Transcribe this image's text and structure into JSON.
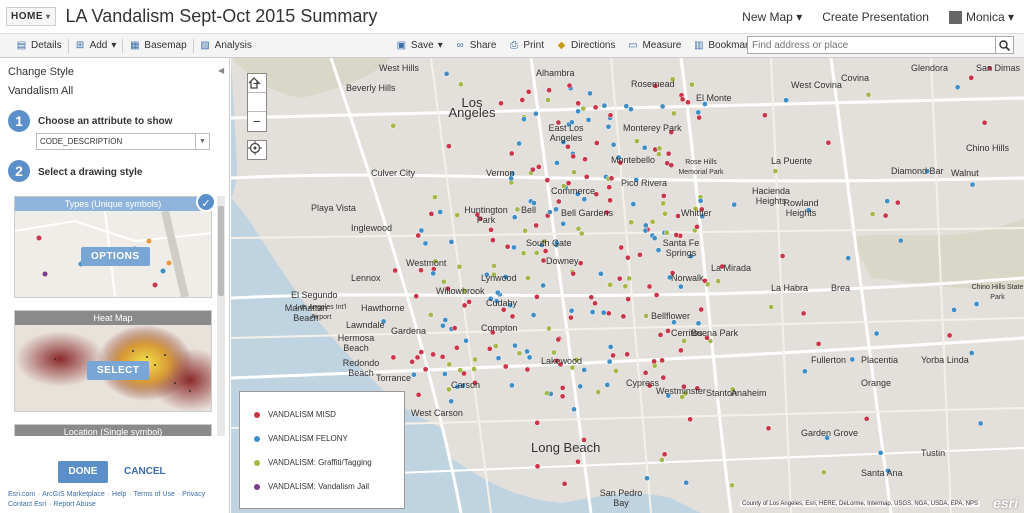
{
  "header": {
    "home_label": "HOME",
    "title": "LA Vandalism Sept-Oct 2015 Summary",
    "new_map": "New Map",
    "create_presentation": "Create Presentation",
    "user": "Monica"
  },
  "toolbar": {
    "details": "Details",
    "add": "Add",
    "basemap": "Basemap",
    "analysis": "Analysis",
    "save": "Save",
    "share": "Share",
    "print": "Print",
    "directions": "Directions",
    "measure": "Measure",
    "bookmarks": "Bookmarks",
    "search_placeholder": "Find address or place"
  },
  "panel": {
    "heading": "Change Style",
    "layer": "Vandalism All",
    "step1_num": "1",
    "step1_label": "Choose an attribute to show",
    "attribute": "CODE_DESCRIPTION",
    "step2_num": "2",
    "step2_label": "Select a drawing style",
    "styles": [
      {
        "title": "Types (Unique symbols)",
        "button": "OPTIONS"
      },
      {
        "title": "Heat Map",
        "button": "SELECT"
      },
      {
        "title": "Location (Single symbol)"
      }
    ],
    "done": "DONE",
    "cancel": "CANCEL",
    "footer": [
      "Esri.com",
      "ArcGIS Marketplace",
      "Help",
      "Terms of Use",
      "Privacy",
      "Contact Esri",
      "Report Abuse"
    ]
  },
  "legend": [
    {
      "label": "VANDALISM MISD",
      "color": "#c8364a"
    },
    {
      "label": "VANDALISM FELONY",
      "color": "#3f8ec5"
    },
    {
      "label": "VANDALISM: Graffiti/Tagging",
      "color": "#a3b849"
    },
    {
      "label": "VANDALISM: Vandalism Jail",
      "color": "#7a3c8a"
    }
  ],
  "map": {
    "attribution": "County of Los Angeles, Esri, HERE, DeLorme, Intermap, USGS, NGA, USDA, EPA, NPS",
    "logo": "esri",
    "cities": [
      {
        "name": "West Hills"
      },
      {
        "name": "Beverly Hills"
      },
      {
        "name": "Los Angeles"
      },
      {
        "name": "Alhambra"
      },
      {
        "name": "Rosemead"
      },
      {
        "name": "El Monte"
      },
      {
        "name": "West Covina"
      },
      {
        "name": "Covina"
      },
      {
        "name": "Glendora"
      },
      {
        "name": "San Dimas"
      },
      {
        "name": "East Los Angeles"
      },
      {
        "name": "Monterey Park"
      },
      {
        "name": "Montebello"
      },
      {
        "name": "Rose Hills Memorial Park"
      },
      {
        "name": "La Puente"
      },
      {
        "name": "Diamond Bar"
      },
      {
        "name": "Walnut"
      },
      {
        "name": "Chino Hills"
      },
      {
        "name": "Culver City"
      },
      {
        "name": "Vernon"
      },
      {
        "name": "Commerce"
      },
      {
        "name": "Pico Rivera"
      },
      {
        "name": "Whittier"
      },
      {
        "name": "Hacienda Heights"
      },
      {
        "name": "Rowland Heights"
      },
      {
        "name": "Playa Vista"
      },
      {
        "name": "Inglewood"
      },
      {
        "name": "Huntington Park"
      },
      {
        "name": "Bell"
      },
      {
        "name": "Bell Gardens"
      },
      {
        "name": "South Gate"
      },
      {
        "name": "Downey"
      },
      {
        "name": "Santa Fe Springs"
      },
      {
        "name": "La Mirada"
      },
      {
        "name": "Norwalk"
      },
      {
        "name": "El Segundo"
      },
      {
        "name": "Los Angeles Int'l Airport"
      },
      {
        "name": "Lennox"
      },
      {
        "name": "Westmont"
      },
      {
        "name": "Hawthorne"
      },
      {
        "name": "Lynwood"
      },
      {
        "name": "Willowbrook"
      },
      {
        "name": "Bellflower"
      },
      {
        "name": "Cerritos"
      },
      {
        "name": "La Habra"
      },
      {
        "name": "Brea"
      },
      {
        "name": "Chino Hills State Park"
      },
      {
        "name": "Manhattan Beach"
      },
      {
        "name": "Lawndale"
      },
      {
        "name": "Gardena"
      },
      {
        "name": "Compton"
      },
      {
        "name": "Lakewood"
      },
      {
        "name": "Buena Park"
      },
      {
        "name": "Fullerton"
      },
      {
        "name": "Placentia"
      },
      {
        "name": "Yorba Linda"
      },
      {
        "name": "Hermosa Beach"
      },
      {
        "name": "Redondo Beach"
      },
      {
        "name": "Torrance"
      },
      {
        "name": "Carson"
      },
      {
        "name": "Cypress"
      },
      {
        "name": "Anaheim"
      },
      {
        "name": "Orange"
      },
      {
        "name": "West Carson"
      },
      {
        "name": "Long Beach"
      },
      {
        "name": "Garden Grove"
      },
      {
        "name": "Santa Ana"
      },
      {
        "name": "Tustin"
      },
      {
        "name": "San Pedro Bay"
      },
      {
        "name": "Cudahy"
      },
      {
        "name": "Westminster"
      },
      {
        "name": "Stanton"
      }
    ]
  }
}
